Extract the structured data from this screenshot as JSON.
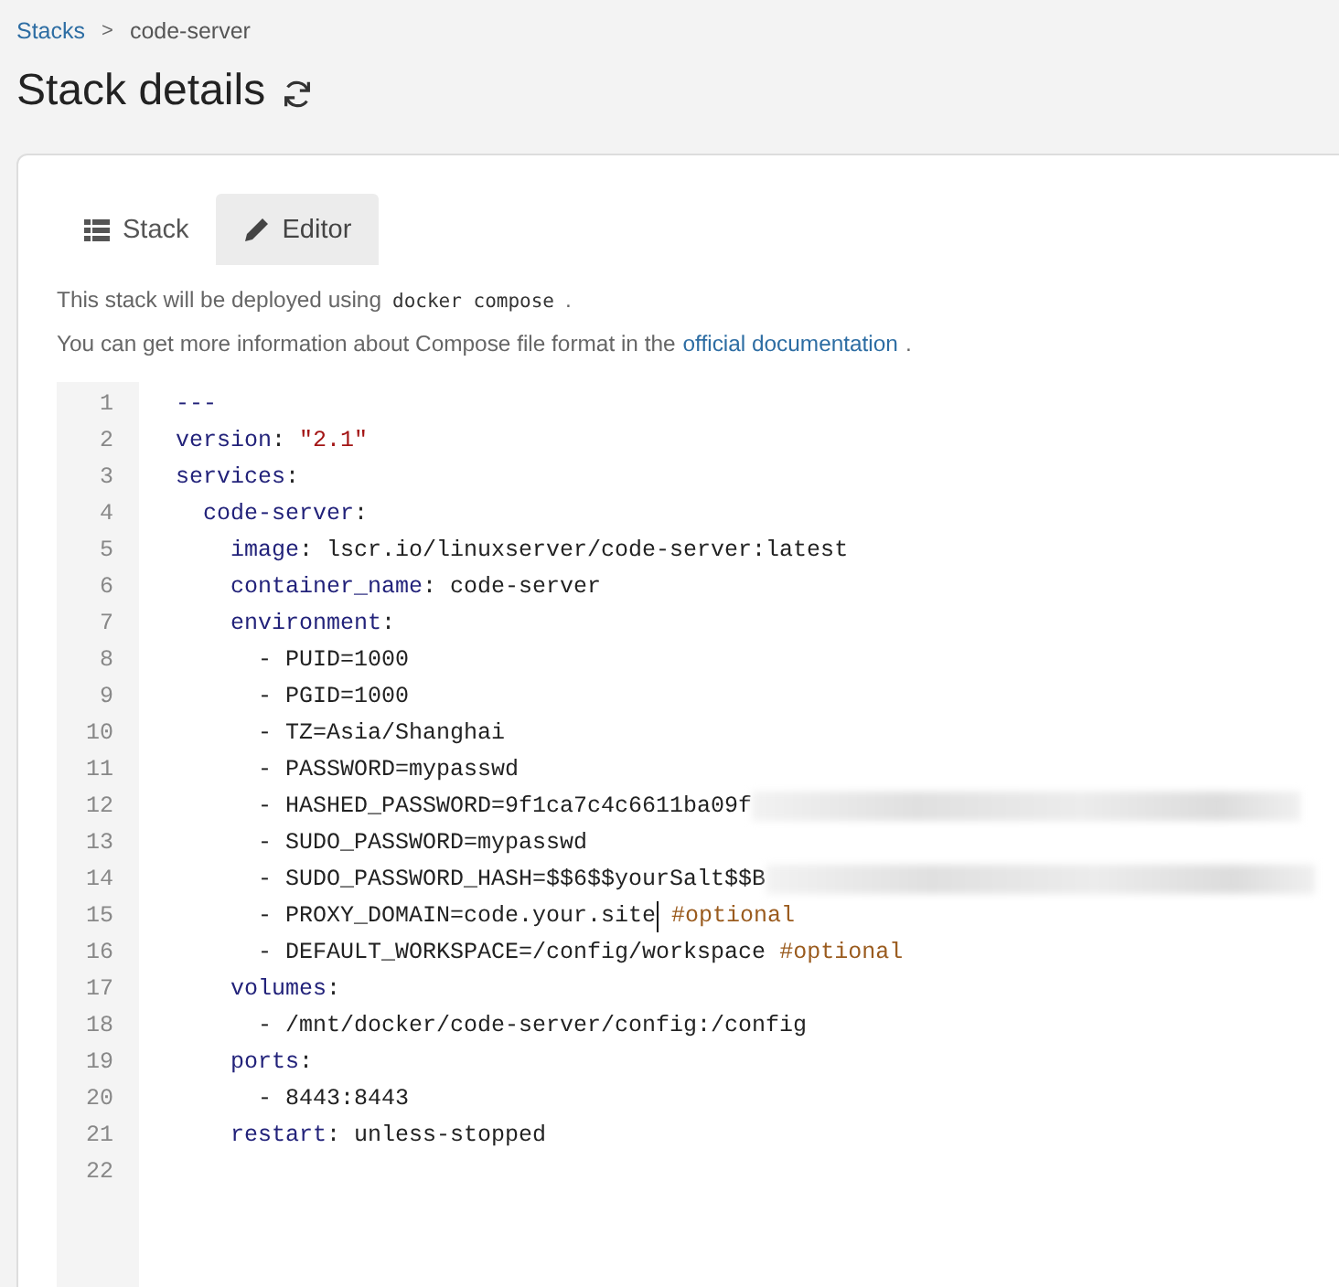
{
  "breadcrumb": [
    {
      "label": "Stacks",
      "kind": "link"
    },
    {
      "label": ">",
      "kind": "separator"
    },
    {
      "label": "code-server",
      "kind": "current"
    }
  ],
  "title": "Stack details",
  "tabs": [
    {
      "label": "Stack",
      "kind": "overview",
      "selected": false
    },
    {
      "label": "Editor",
      "kind": "editor",
      "selected": true
    }
  ],
  "info": {
    "before": "This stack will be deployed using",
    "command": "docker compose",
    "after": "."
  },
  "docs": {
    "text": "You can get more information about Compose file format in the",
    "link": "official documentation",
    "after": "."
  },
  "editor": {
    "lines": [
      {
        "number": "1",
        "tokens": [
          {
            "kind": "key",
            "text": "---"
          }
        ]
      },
      {
        "number": "2",
        "tokens": [
          {
            "kind": "key",
            "text": "version"
          },
          {
            "kind": "plain",
            "text": ": "
          },
          {
            "kind": "string",
            "text": "\"2.1\""
          }
        ]
      },
      {
        "number": "3",
        "tokens": [
          {
            "kind": "key",
            "text": "services"
          },
          {
            "kind": "plain",
            "text": ":"
          }
        ]
      },
      {
        "number": "4",
        "tokens": [
          {
            "kind": "key",
            "text": "  code-server"
          },
          {
            "kind": "plain",
            "text": ":"
          }
        ]
      },
      {
        "number": "5",
        "tokens": [
          {
            "kind": "key",
            "text": "    image"
          },
          {
            "kind": "plain",
            "text": ": lscr.io/linuxserver/code-server:latest"
          }
        ]
      },
      {
        "number": "6",
        "tokens": [
          {
            "kind": "key",
            "text": "    container_name"
          },
          {
            "kind": "plain",
            "text": ": code-server"
          }
        ]
      },
      {
        "number": "7",
        "tokens": [
          {
            "kind": "key",
            "text": "    environment"
          },
          {
            "kind": "plain",
            "text": ":"
          }
        ]
      },
      {
        "number": "8",
        "tokens": [
          {
            "kind": "plain",
            "text": "      - PUID=1000"
          }
        ]
      },
      {
        "number": "9",
        "tokens": [
          {
            "kind": "plain",
            "text": "      - PGID=1000"
          }
        ]
      },
      {
        "number": "10",
        "tokens": [
          {
            "kind": "plain",
            "text": "      - TZ=Asia/Shanghai"
          }
        ]
      },
      {
        "number": "11",
        "tokens": [
          {
            "kind": "plain",
            "text": "      - PASSWORD=mypasswd"
          }
        ]
      },
      {
        "number": "12",
        "tokens": [
          {
            "kind": "plain",
            "text": "      - HASHED_PASSWORD=9f1ca7c4c6611ba09f"
          },
          {
            "kind": "redacted"
          }
        ]
      },
      {
        "number": "13",
        "tokens": [
          {
            "kind": "plain",
            "text": "      - SUDO_PASSWORD=mypasswd"
          }
        ]
      },
      {
        "number": "14",
        "tokens": [
          {
            "kind": "plain",
            "text": "      - SUDO_PASSWORD_HASH=$$6$$yourSalt$$B"
          },
          {
            "kind": "redacted"
          }
        ]
      },
      {
        "number": "15",
        "tokens": [
          {
            "kind": "plain",
            "text": "      - PROXY_DOMAIN=code.your.site"
          },
          {
            "kind": "cursor"
          },
          {
            "kind": "comment",
            "text": "#optional"
          }
        ]
      },
      {
        "number": "16",
        "tokens": [
          {
            "kind": "plain",
            "text": "      - DEFAULT_WORKSPACE=/config/workspace "
          },
          {
            "kind": "comment",
            "text": "#optional"
          }
        ]
      },
      {
        "number": "17",
        "tokens": [
          {
            "kind": "key",
            "text": "    volumes"
          },
          {
            "kind": "plain",
            "text": ":"
          }
        ]
      },
      {
        "number": "18",
        "tokens": [
          {
            "kind": "plain",
            "text": "      - /mnt/docker/code-server/config:/config"
          }
        ]
      },
      {
        "number": "19",
        "tokens": [
          {
            "kind": "key",
            "text": "    ports"
          },
          {
            "kind": "plain",
            "text": ":"
          }
        ]
      },
      {
        "number": "20",
        "tokens": [
          {
            "kind": "plain",
            "text": "      - 8443:8443"
          }
        ]
      },
      {
        "number": "21",
        "tokens": [
          {
            "kind": "key",
            "text": "    restart"
          },
          {
            "kind": "plain",
            "text": ": unless-stopped"
          }
        ]
      },
      {
        "number": "22"
      }
    ]
  }
}
